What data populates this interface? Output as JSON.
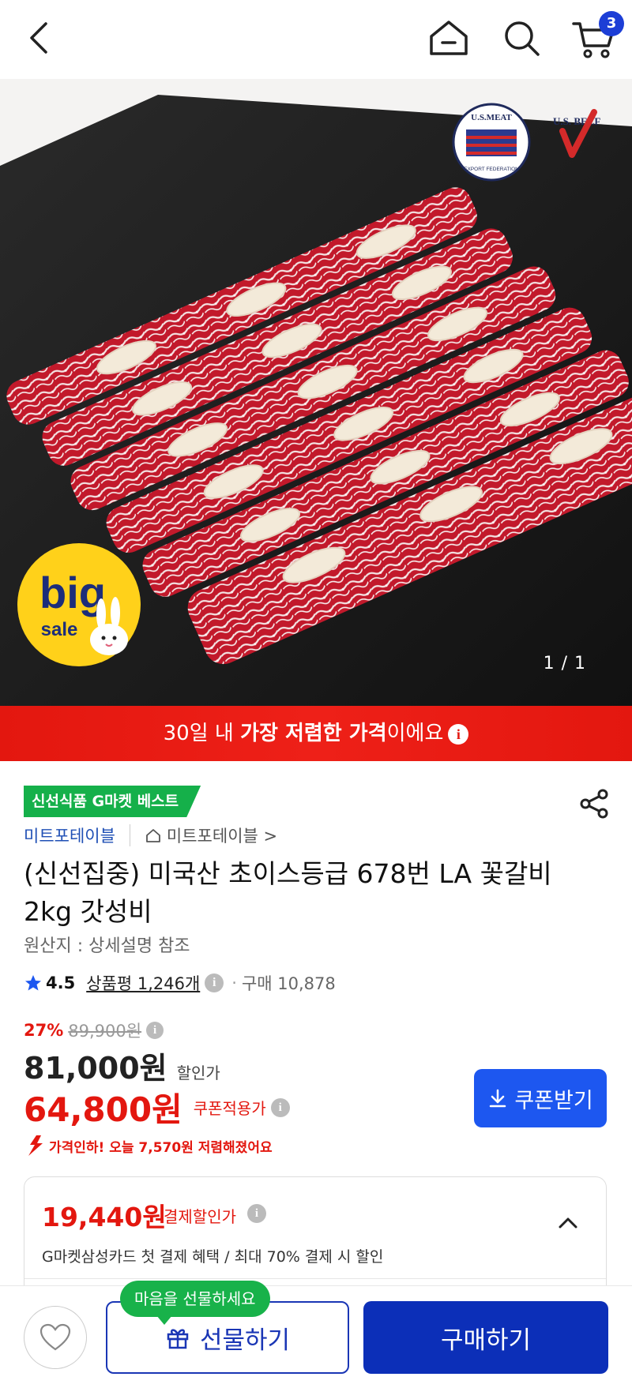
{
  "header": {
    "cart_count": "3",
    "icons": [
      "back-icon",
      "home-icon",
      "search-icon",
      "cart-icon"
    ]
  },
  "hero": {
    "image_counter": "1 / 1",
    "badge_big": "big",
    "badge_sale": "sale",
    "logo_usmeat_text": "U.S.MEAT",
    "logo_usmeat_sub": "EXPORT FEDERATION",
    "logo_usbeef_text": "U.S. BEEF"
  },
  "banner": {
    "prefix": "30일 내 ",
    "highlight": "가장 저렴한 가격",
    "suffix": "이에요",
    "info": "i"
  },
  "product": {
    "best_badge": "신선식품 G마켓 베스트",
    "seller": "미트포테이블",
    "shop_link": "미트포테이블 >",
    "title": "(신선집중) 미국산 초이스등급 678번 LA 꽃갈비 2kg 갓성비",
    "origin": "원산지 : 상세설명 참조",
    "rating": "4.5",
    "reviews": "상품평 1,246개",
    "purchases": "구매 10,878",
    "dot": "·",
    "info": "i"
  },
  "price": {
    "discount_pct": "27%",
    "original": "89,900원",
    "sale_price": "81,000원",
    "sale_label": "할인가",
    "coupon_price": "64,800원",
    "coupon_label": "쿠폰적용가",
    "coupon_button": "쿠폰받기",
    "drop_notice": "가격인하! 오늘 7,570원 저렴해졌어요"
  },
  "payment_card": {
    "amount": "19,440원",
    "label": "결제할인가",
    "description": "G마켓삼성카드 첫 결제 혜택 / 최대 70% 결제 시 할인"
  },
  "bottom": {
    "tooltip": "마음을 선물하세요",
    "gift_button": "선물하기",
    "buy_button": "구매하기"
  },
  "colors": {
    "accent_blue": "#1d57f0",
    "buy_blue": "#0c2fb8",
    "sale_red": "#e3170f",
    "best_green": "#15b04a"
  }
}
